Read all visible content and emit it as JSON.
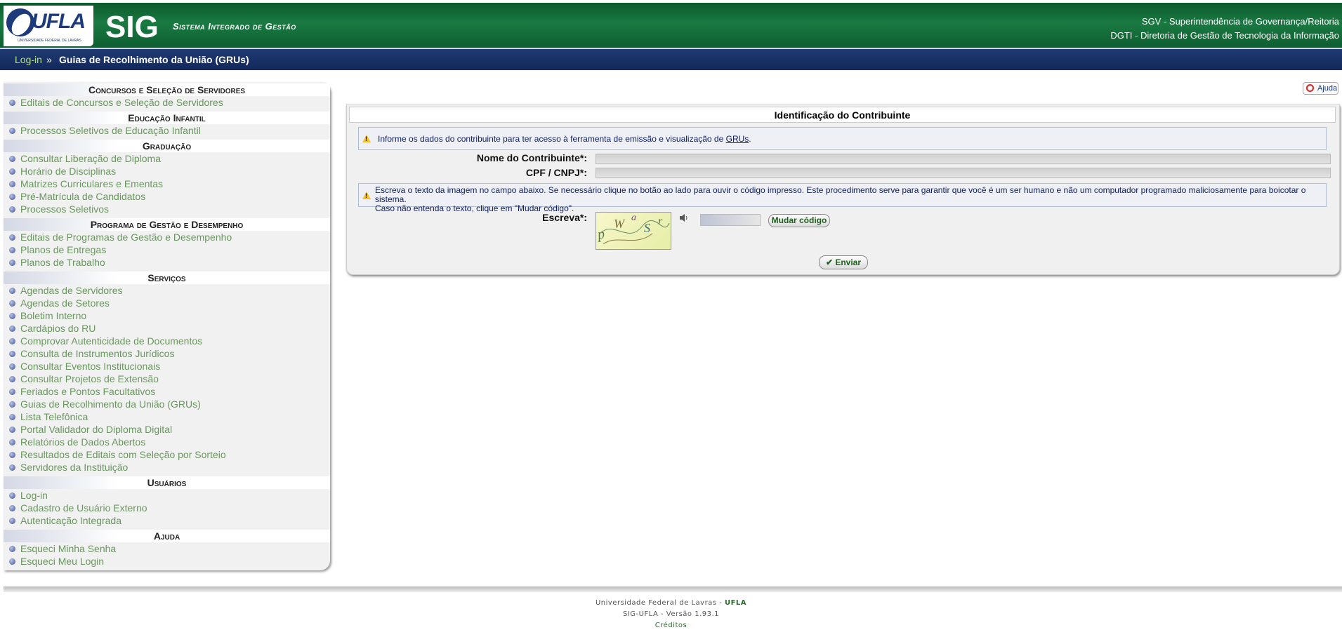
{
  "header": {
    "logo_text": "UFLA",
    "logo_subtitle": "UNIVERSIDADE FEDERAL DE LAVRAS",
    "app_title": "SIG",
    "app_subtitle": "Sistema Integrado de Gestão",
    "org_line1": "SGV - Superintendência de Governança/Reitoria",
    "org_line2": "DGTI - Diretoria de Gestão de Tecnologia da Informação"
  },
  "breadcrumb": {
    "link": "Log-in",
    "separator": "»",
    "current": "Guias de Recolhimento da União (GRUs)"
  },
  "sidebar": {
    "sections": [
      {
        "title": "Concursos e Seleção de Servidores",
        "items": [
          "Editais de Concursos e Seleção de Servidores"
        ]
      },
      {
        "title": "Educação Infantil",
        "items": [
          "Processos Seletivos de Educação Infantil"
        ]
      },
      {
        "title": "Graduação",
        "items": [
          "Consultar Liberação de Diploma",
          "Horário de Disciplinas",
          "Matrizes Curriculares e Ementas",
          "Pré-Matrícula de Candidatos",
          "Processos Seletivos"
        ]
      },
      {
        "title": "Programa de Gestão e Desempenho",
        "items": [
          "Editais de Programas de Gestão e Desempenho",
          "Planos de Entregas",
          "Planos de Trabalho"
        ]
      },
      {
        "title": "Serviços",
        "items": [
          "Agendas de Servidores",
          "Agendas de Setores",
          "Boletim Interno",
          "Cardápios do RU",
          "Comprovar Autenticidade de Documentos",
          "Consulta de Instrumentos Jurídicos",
          "Consultar Eventos Institucionais",
          "Consultar Projetos de Extensão",
          "Feriados e Pontos Facultativos",
          "Guias de Recolhimento da União (GRUs)",
          "Lista Telefônica",
          "Portal Validador do Diploma Digital",
          "Relatórios de Dados Abertos",
          "Resultados de Editais com Seleção por Sorteio",
          "Servidores da Instituição"
        ]
      },
      {
        "title": "Usuários",
        "items": [
          "Log-in",
          "Cadastro de Usuário Externo",
          "Autenticação Integrada"
        ]
      },
      {
        "title": "Ajuda",
        "items": [
          "Esqueci Minha Senha",
          "Esqueci Meu Login"
        ]
      }
    ]
  },
  "help_button": "Ajuda",
  "form": {
    "title": "Identificação do Contribuinte",
    "notice1_prefix": "Informe os dados do contribuinte para ter acesso à ferramenta de emissão e visualização de ",
    "notice1_link": "GRUs",
    "notice1_suffix": ".",
    "name_label": "Nome do Contribuinte*:",
    "name_value": "",
    "cpf_label": "CPF / CNPJ*:",
    "cpf_value": "",
    "notice2_line1": "Escreva o texto da imagem no campo abaixo. Se necessário clique no botão ao lado para ouvir o código impresso. Este procedimento serve para garantir que você é um ser humano e não um computador programado maliciosamente para boicotar o sistema.",
    "notice2_line2": "Caso não entenda o texto, clique em \"Mudar código\".",
    "captcha_label": "Escreva*:",
    "captcha_chars": [
      "p",
      "W",
      "a",
      "S",
      "r"
    ],
    "captcha_value": "",
    "change_code_button": "Mudar código",
    "submit_button": "✔ Enviar"
  },
  "footer": {
    "line1_prefix": "Universidade Federal de Lavras - ",
    "line1_org": "UFLA",
    "line2": "SIG-UFLA - Versão 1.93.1",
    "credits": "Créditos"
  }
}
